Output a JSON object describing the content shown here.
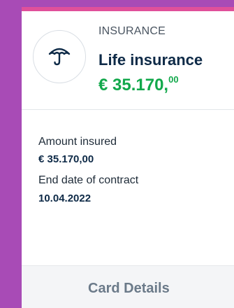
{
  "card": {
    "category": "INSURANCE",
    "title": "Life insurance",
    "amount_main": "€ 35.170,",
    "amount_cents": "00",
    "icon": "umbrella-icon",
    "accent_color": "#e0509a",
    "amount_color": "#12a84b",
    "details": [
      {
        "label": "Amount insured",
        "value": "€ 35.170,00"
      },
      {
        "label": "End date of contract",
        "value": "10.04.2022"
      }
    ],
    "footer_label": "Card Details"
  }
}
